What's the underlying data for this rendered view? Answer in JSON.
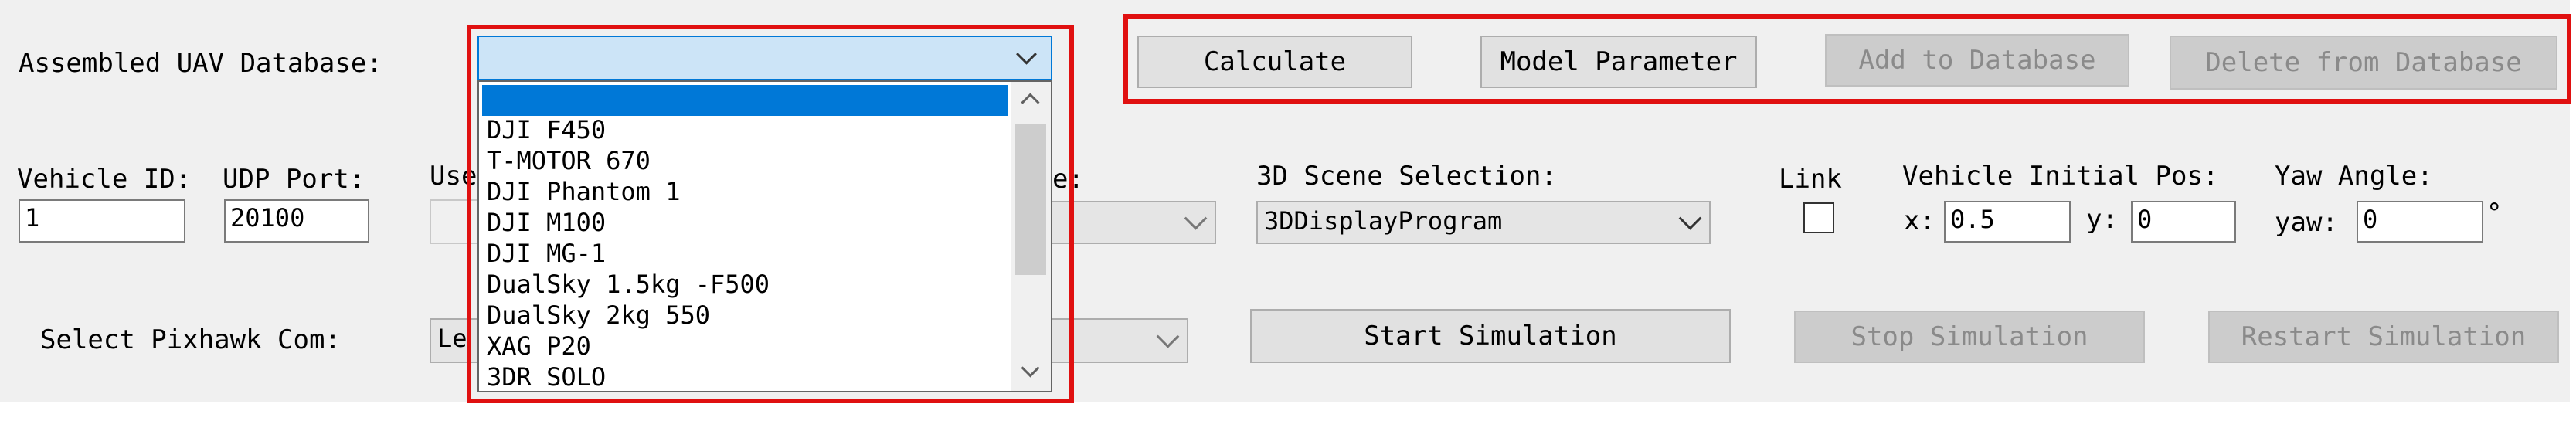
{
  "database": {
    "label": "Assembled UAV Database:",
    "selected_value": "",
    "options": [
      "",
      "DJI F450",
      "T-MOTOR 670",
      "DJI Phantom 1",
      "DJI M100",
      "DJI MG-1",
      "DualSky 1.5kg -F500",
      "DualSky 2kg 550",
      "XAG P20",
      "3DR SOLO"
    ]
  },
  "toolbar": {
    "calculate": "Calculate",
    "model_parameter": "Model Parameter",
    "add_to_database": "Add to Database",
    "delete_from_database": "Delete from Database"
  },
  "vehicle": {
    "id_label": "Vehicle ID:",
    "id_value": "1",
    "udp_label": "UDP Port:",
    "udp_value": "20100",
    "use_label_partial": "Use",
    "hidden_label_partial": "e:"
  },
  "scene": {
    "label": "3D Scene Selection:",
    "value": "3DDisplayProgram"
  },
  "link": {
    "label": "Link",
    "checked": false
  },
  "initial_pos": {
    "label": "Vehicle Initial Pos:",
    "x_label": "x:",
    "x_value": "0.5",
    "y_label": "y:",
    "y_value": "0"
  },
  "yaw": {
    "label": "Yaw Angle:",
    "yaw_label": "yaw:",
    "yaw_value": "0",
    "unit": "°"
  },
  "pixhawk": {
    "label": "Select Pixhawk Com:",
    "value_partial": "Le"
  },
  "simulation": {
    "start": "Start Simulation",
    "stop": "Stop Simulation",
    "restart": "Restart Simulation"
  },
  "colors": {
    "highlight_box": "#e01010",
    "selection": "#0078d7",
    "panel": "#f0f0f0"
  }
}
